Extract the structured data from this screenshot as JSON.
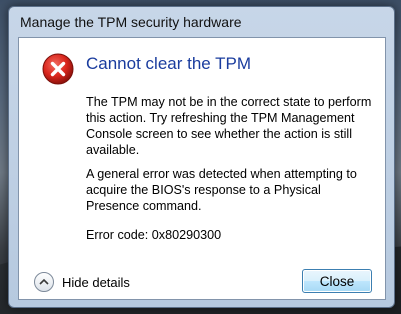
{
  "window": {
    "title": "Manage the TPM security hardware"
  },
  "dialog": {
    "icon": "error-icon",
    "heading": "Cannot clear the TPM",
    "paragraphs": [
      "The TPM may not be in the correct state to perform this action. Try refreshing the TPM Management Console screen to see whether the action is still available.",
      "A general error was detected when attempting to acquire the BIOS's response to a Physical Presence command.",
      "Error code: 0x80290300"
    ]
  },
  "footer": {
    "details_label": "Hide details",
    "close_label": "Close"
  },
  "colors": {
    "heading": "#1a3c9e",
    "error_red": "#d9251c",
    "button_border": "#3c7fb1"
  }
}
